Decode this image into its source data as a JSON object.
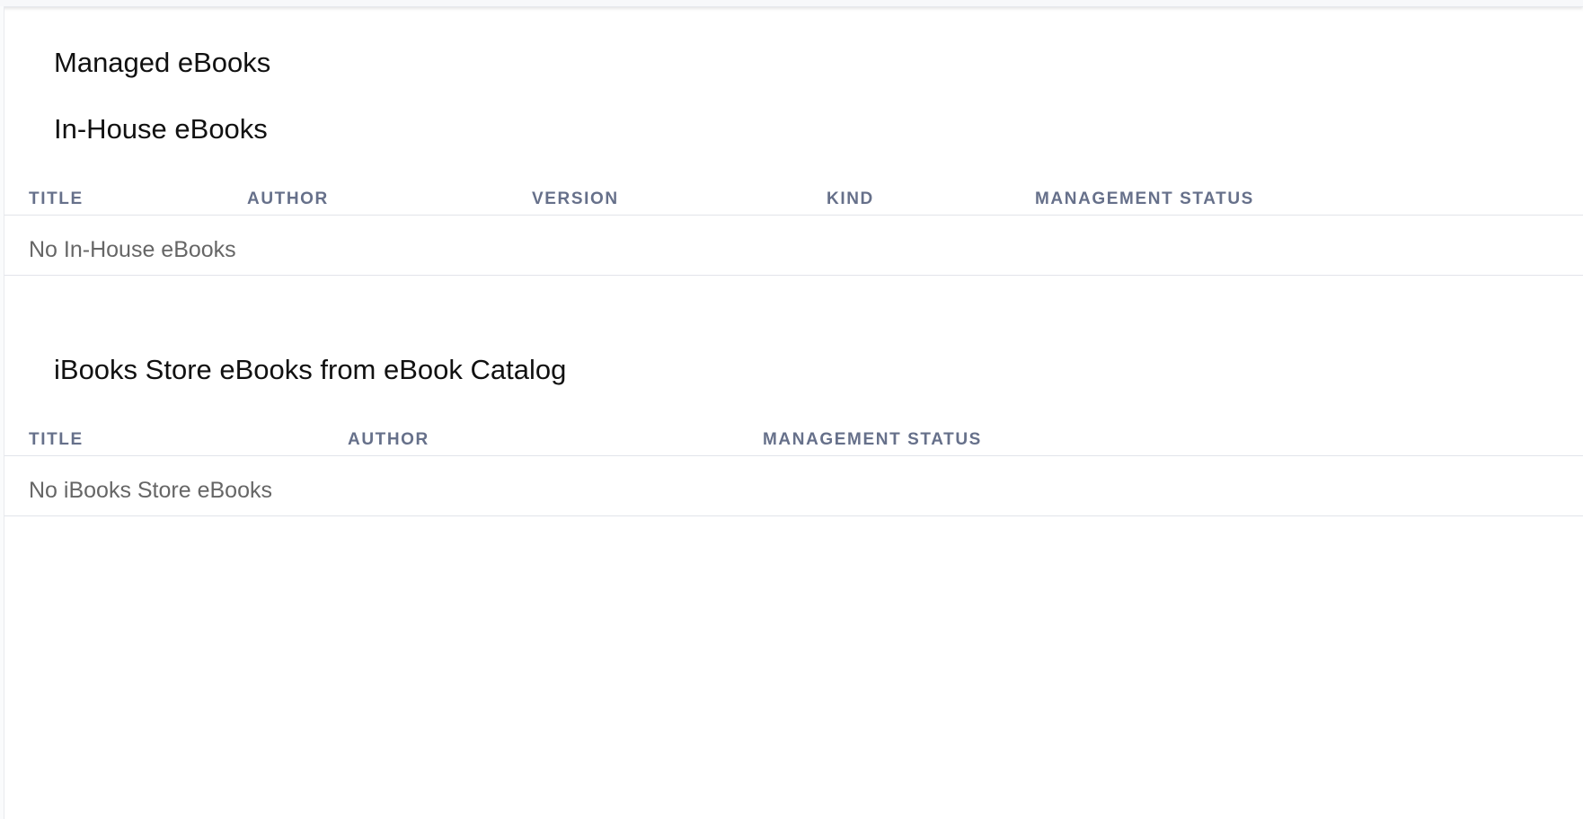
{
  "page_title": "Managed eBooks",
  "in_house": {
    "title": "In-House eBooks",
    "columns": [
      "TITLE",
      "AUTHOR",
      "VERSION",
      "KIND",
      "MANAGEMENT STATUS"
    ],
    "empty_text": "No In-House eBooks"
  },
  "ibooks_store": {
    "title": "iBooks Store eBooks from eBook Catalog",
    "columns": [
      "TITLE",
      "AUTHOR",
      "MANAGEMENT STATUS"
    ],
    "empty_text": "No iBooks Store eBooks"
  },
  "colors": {
    "header_text": "#66708a",
    "empty_text": "#666666",
    "divider": "#e2e4ea"
  }
}
